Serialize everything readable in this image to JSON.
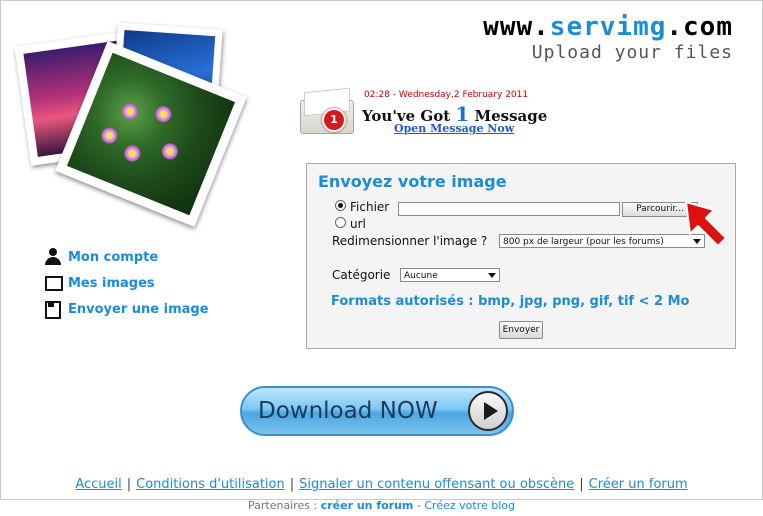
{
  "logo": {
    "prefix": "www.",
    "brand": "servimg",
    "suffix": ".com",
    "tagline": "Upload your files"
  },
  "ad": {
    "datetime": "02:28 - Wednesday,2 February 2011",
    "badge_count": "1",
    "title_prefix": "You've Got ",
    "title_num": "1",
    "title_suffix": " Message",
    "link": "Open Message Now"
  },
  "menu": {
    "items": [
      {
        "label": "Mon compte",
        "icon": "user-icon"
      },
      {
        "label": "Mes images",
        "icon": "screen-icon"
      },
      {
        "label": "Envoyer une image",
        "icon": "upload-disk-icon"
      }
    ]
  },
  "upload": {
    "title": "Envoyez votre image",
    "radio_file": "Fichier",
    "radio_url": "url",
    "file_value": "",
    "browse_label": "Parcourir...",
    "resize_label": "Redimensionner l'image ?",
    "resize_value": "800 px de largeur (pour les forums)",
    "category_label": "Catégorie",
    "category_value": "Aucune",
    "formats": "Formats autorisés : bmp, jpg, png, gif, tif < 2 Mo",
    "submit_label": "Envoyer"
  },
  "download_button": {
    "label": "Download NOW"
  },
  "footer": {
    "links": [
      "Accueil",
      "Conditions d'utilisation",
      "Signaler un contenu offensant ou obscène",
      "Créer un forum"
    ],
    "partners_label": "Partenaires : ",
    "partner_strong": "créer un forum",
    "partner_sep": " - ",
    "partner_blog": "Créez votre blog"
  },
  "colors": {
    "accent": "#1a8cd8",
    "badge": "#d41b1b",
    "arrow": "#e01010"
  }
}
